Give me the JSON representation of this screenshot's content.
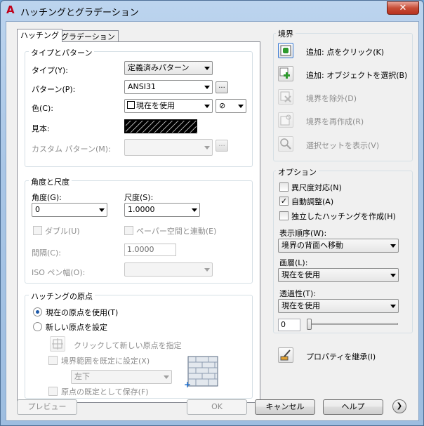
{
  "window": {
    "title": "ハッチングとグラデーション",
    "close_glyph": "✕",
    "app_icon_glyph": "A"
  },
  "tabs": [
    {
      "label": "ハッチング",
      "active": true
    },
    {
      "label": "グラデーション",
      "active": false
    }
  ],
  "type_pattern": {
    "group_label": "タイプとパターン",
    "type_label": "タイプ(Y):",
    "type_value": "定義済みパターン",
    "pattern_label": "パターン(P):",
    "pattern_value": "ANSI31",
    "color_label": "色(C):",
    "color_value": "現在を使用",
    "color_bg_glyph": "⊘",
    "sample_label": "見本:",
    "custom_label": "カスタム パターン(M):",
    "browse_glyph": "..."
  },
  "angle_scale": {
    "group_label": "角度と尺度",
    "angle_label": "角度(G):",
    "angle_value": "0",
    "scale_label": "尺度(S):",
    "scale_value": "1.0000",
    "double_label": "ダブル(U)",
    "paper_label": "ペーパー空間と連動(E)",
    "spacing_label": "間隔(C):",
    "spacing_value": "1.0000",
    "iso_label": "ISO ペン幅(O):"
  },
  "origin": {
    "group_label": "ハッチングの原点",
    "use_current_label": "現在の原点を使用(T)",
    "use_current_selected": true,
    "new_origin_label": "新しい原点を設定",
    "click_label": "クリックして新しい原点を指定",
    "default_boundary_label": "境界範囲を既定に設定(X)",
    "position_value": "左下",
    "store_label": "原点の既定として保存(F)"
  },
  "boundaries": {
    "group_label": "境界",
    "add_pick_label": "追加: 点をクリック(K)",
    "add_select_label": "追加: オブジェクトを選択(B)",
    "remove_label": "境界を除外(D)",
    "recreate_label": "境界を再作成(R)",
    "view_label": "選択セットを表示(V)"
  },
  "options": {
    "group_label": "オプション",
    "annotative_label": "異尺度対応(N)",
    "annotative_checked": false,
    "associative_label": "自動調整(A)",
    "associative_checked": true,
    "separate_label": "独立したハッチングを作成(H)",
    "separate_checked": false,
    "draw_order_label": "表示順序(W):",
    "draw_order_value": "境界の背面へ移動",
    "layer_label": "画層(L):",
    "layer_value": "現在を使用",
    "transparency_label": "透過性(T):",
    "transparency_value": "現在を使用",
    "transparency_amount": "0",
    "inherit_label": "プロパティを継承(I)"
  },
  "footer": {
    "preview_label": "プレビュー",
    "ok_label": "OK",
    "cancel_label": "キャンセル",
    "help_label": "ヘルプ",
    "more_glyph": "❯"
  },
  "check_glyph": "✓",
  "colors": {
    "title_bar": "#a9c6e6",
    "close_button": "#c74d36",
    "dialog_bg": "#f0f0f0",
    "accent_blue": "#1c58a8",
    "add_icon_green": "#2e9a2e"
  }
}
